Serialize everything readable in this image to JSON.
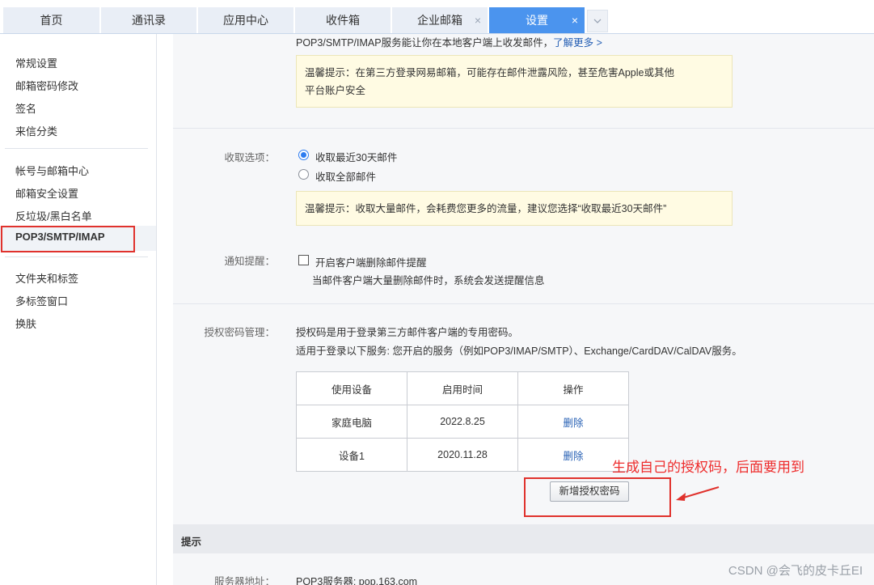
{
  "tabs": [
    {
      "label": "首页",
      "closable": false,
      "active": false
    },
    {
      "label": "通讯录",
      "closable": false,
      "active": false
    },
    {
      "label": "应用中心",
      "closable": false,
      "active": false
    },
    {
      "label": "收件箱",
      "closable": false,
      "active": false
    },
    {
      "label": "企业邮箱",
      "closable": true,
      "active": false
    },
    {
      "label": "设置",
      "closable": true,
      "active": true
    }
  ],
  "tab_close_glyph": "×",
  "tab_more_icon": "chevron-down-icon",
  "sidebar": {
    "group1": [
      "常规设置",
      "邮箱密码修改",
      "签名",
      "来信分类"
    ],
    "group2": [
      "帐号与邮箱中心",
      "邮箱安全设置",
      "反垃圾/黑白名单",
      "POP3/SMTP/IMAP"
    ],
    "group3": [
      "文件夹和标签",
      "多标签窗口",
      "换肤"
    ],
    "active": "POP3/SMTP/IMAP"
  },
  "intro": {
    "text": "POP3/SMTP/IMAP服务能让你在本地客户端上收发邮件，",
    "link": "了解更多 >"
  },
  "tip1": {
    "line1": "温馨提示：在第三方登录网易邮箱，可能存在邮件泄露风险，甚至危害Apple或其他",
    "line2": "平台账户安全"
  },
  "receive": {
    "label": "收取选项：",
    "options": [
      {
        "text": "收取最近30天邮件",
        "checked": true
      },
      {
        "text": "收取全部邮件",
        "checked": false
      }
    ],
    "tip": "温馨提示：收取大量邮件，会耗费您更多的流量，建议您选择“收取最近30天邮件”"
  },
  "notify": {
    "label": "通知提醒：",
    "checkbox_text": "开启客户端删除邮件提醒",
    "checked": false,
    "desc": "当邮件客户端大量删除邮件时，系统会发送提醒信息"
  },
  "auth": {
    "label": "授权密码管理：",
    "line1": "授权码是用于登录第三方邮件客户端的专用密码。",
    "line2": "适用于登录以下服务: 您开启的服务（例如POP3/IMAP/SMTP）、Exchange/CardDAV/CalDAV服务。",
    "columns": [
      "使用设备",
      "启用时间",
      "操作"
    ],
    "rows": [
      {
        "device": "家庭电脑",
        "date": "2022.8.25",
        "action": "删除"
      },
      {
        "device": "设备1",
        "date": "2020.11.28",
        "action": "删除"
      }
    ],
    "new_button": "新增授权密码",
    "annotation": "生成自己的授权码，后面要用到"
  },
  "hint": {
    "title": "提示"
  },
  "server": {
    "label": "服务器地址：",
    "value": "POP3服务器: pop.163.com"
  },
  "watermark": "CSDN @会飞的皮卡丘EI",
  "colors": {
    "tab_active": "#4b94ee",
    "highlight_red": "#e0322d",
    "link_blue": "#2861b5",
    "tip_bg": "#fffbe3"
  }
}
